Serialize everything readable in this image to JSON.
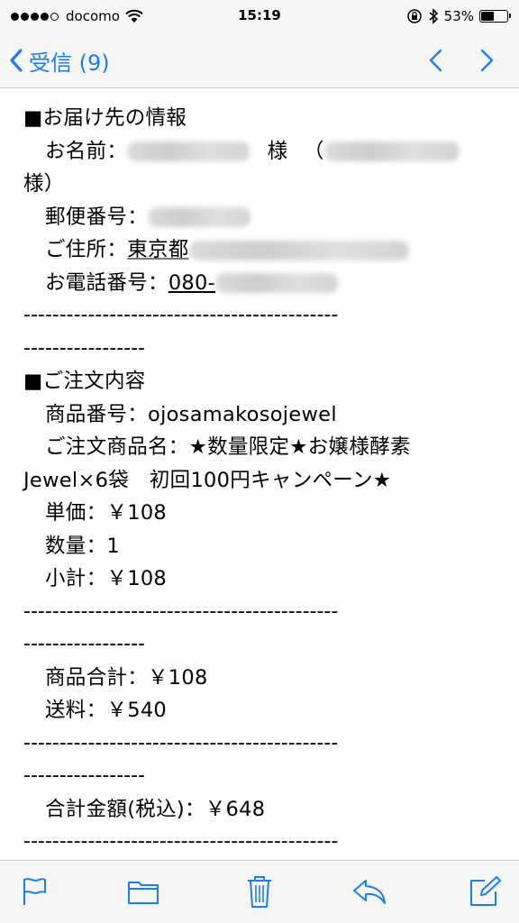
{
  "status_bar": {
    "carrier": "docomo",
    "time": "15:19",
    "battery_percent": "53%",
    "battery_level": 0.53
  },
  "nav": {
    "back_label": "受信 (9)"
  },
  "accent_color": "#1a7ff4",
  "email": {
    "delivery_header": "■お届け先の情報",
    "name_label": "お名前：",
    "name_honorific": "様",
    "name_paren_open": "（",
    "name_wrap": "様）",
    "postal_label": "郵便番号：",
    "address_label": "ご住所：",
    "address_value": "東京都",
    "phone_label": "お電話番号：",
    "phone_value": "080-",
    "separator_1": "--------------------------------------------",
    "separator_2": "-----------------",
    "order_header": "■ご注文内容",
    "product_code_line": "商品番号：ojosamakosojewel",
    "product_name_line": "ご注文商品名：★数量限定★お嬢様酵素",
    "product_name_wrap": "Jewel×6袋　初回100円キャンペーン★",
    "unit_price_line": "単価：￥108",
    "quantity_line": "数量：1",
    "subtotal_line": "小計：￥108",
    "items_total_line": "商品合計：￥108",
    "shipping_line": "送料：￥540",
    "grand_total_line": "合計金額(税込)：￥648"
  },
  "toolbar": {
    "icons": [
      "flag-icon",
      "folder-icon",
      "trash-icon",
      "reply-icon",
      "compose-icon"
    ]
  }
}
